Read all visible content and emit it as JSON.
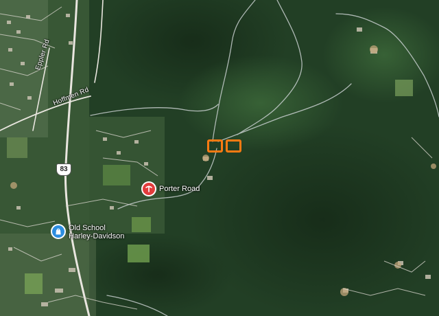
{
  "map": {
    "view": "satellite",
    "roads": {
      "eppler": "Eppler Rd",
      "hoffmen": "Hoffmen Rd",
      "route_shield": "83"
    },
    "places": {
      "porter_road": "Porter Road",
      "harley_line1": "Old School",
      "harley_line2": "Harley-Davidson"
    },
    "markers": {
      "count": 2,
      "color": "#ff7a12"
    },
    "colors": {
      "porter_pin": "#e23c3c",
      "harley_pin": "#2d8ee0",
      "forest": "#1f3a22",
      "trail": "#c8cfcf"
    }
  }
}
